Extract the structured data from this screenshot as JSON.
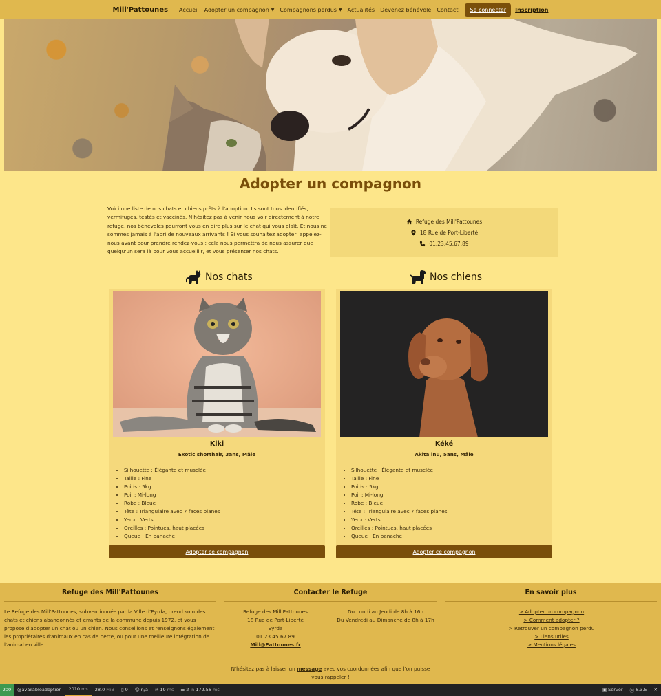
{
  "navbar": {
    "brand": "Mill'Pattounes",
    "links": [
      "Accueil",
      "Adopter un compagnon",
      "Compagnons perdus",
      "Actualités",
      "Devenez bénévole",
      "Contact"
    ],
    "login": "Se connecter",
    "signup": "Inscription"
  },
  "page": {
    "title": "Adopter un compagnon",
    "intro": "Voici une liste de nos chats et chiens prêts à l'adoption. Ils sont tous identifiés, vermifugés, testés et vaccinés. N'hésitez pas à venir nous voir directement à notre refuge, nos bénévoles pourront vous en dire plus sur le chat qui vous plaît. Et nous ne sommes jamais à l'abri de nouveaux arrivants ! Si vous souhaitez adopter, appelez-nous avant pour prendre rendez-vous : cela nous permettra de nous assurer que quelqu'un sera là pour vous accueillir, et vous présenter nos chats."
  },
  "contact": {
    "name": "Refuge des Mill'Pattounes",
    "address": "18 Rue de Port-Liberté",
    "phone": "01.23.45.67.89"
  },
  "cats": {
    "title": "Nos chats",
    "card": {
      "name": "Kiki",
      "sub": "Exotic shorthair, 3ans, Mâle",
      "traits": [
        "Silhouette : Élégante et musclée",
        "Taille : Fine",
        "Poids : 5kg",
        "Poil : Mi-long",
        "Robe : Bleue",
        "Tête : Triangulaire avec 7 faces planes",
        "Yeux : Verts",
        "Oreilles : Pointues, haut placées",
        "Queue : En panache"
      ],
      "button": "Adopter ce compagnon"
    }
  },
  "dogs": {
    "title": "Nos chiens",
    "card": {
      "name": "Kéké",
      "sub": "Akita inu, 5ans, Mâle",
      "traits": [
        "Silhouette : Élégante et musclée",
        "Taille : Fine",
        "Poids : 5kg",
        "Poil : Mi-long",
        "Robe : Bleue",
        "Tête : Triangulaire avec 7 faces planes",
        "Yeux : Verts",
        "Oreilles : Pointues, haut placées",
        "Queue : En panache"
      ],
      "button": "Adopter ce compagnon"
    }
  },
  "footer": {
    "about_title": "Refuge des Mill'Pattounes",
    "about_text": "Le Refuge des Mill'Pattounes, subventionnée par la Ville d'Eyrda, prend soin des chats et chiens abandonnés et errants de la commune depuis 1972, et vous propose d'adopter un chat ou un chien. Nous conseillons et renseignons également les propriétaires d'animaux en cas de perte, ou pour une meilleure intégration de l'animal en ville.",
    "contact_title": "Contacter le Refuge",
    "addr_lines": [
      "Refuge des Mill'Pattounes",
      "18 Rue de Port-Liberté",
      "Eyrda",
      "01.23.45.67.89"
    ],
    "email": "Mill@Pattounes.fr",
    "hours": [
      "Du Lundi au Jeudi de 8h à 16h",
      "Du Vendredi au Dimanche de 8h à 17h"
    ],
    "more_title": "En savoir plus",
    "more_links": [
      "> Adopter un compagnon",
      "> Comment adopter ?",
      "> Retrouver un compagnon perdu",
      "> Liens utiles",
      "> Mentions légales"
    ],
    "bottom_pre": "N'hésitez pas à laisser un ",
    "bottom_link": "message",
    "bottom_post": " avec vos coordonnées afin que l'on puisse vous rappeler !"
  },
  "debugbar": {
    "status": "200",
    "route": "@availableadoption",
    "time": "2010",
    "time_unit": "ms",
    "memory": "28.0",
    "memory_unit": "MiB",
    "forms": "9",
    "user": "n/a",
    "ajax": "19",
    "ajax_unit": "ms",
    "db": "2",
    "db_in": "in",
    "db_time": "172.56",
    "db_unit": "ms",
    "server": "Server",
    "version": "6.3.5"
  }
}
